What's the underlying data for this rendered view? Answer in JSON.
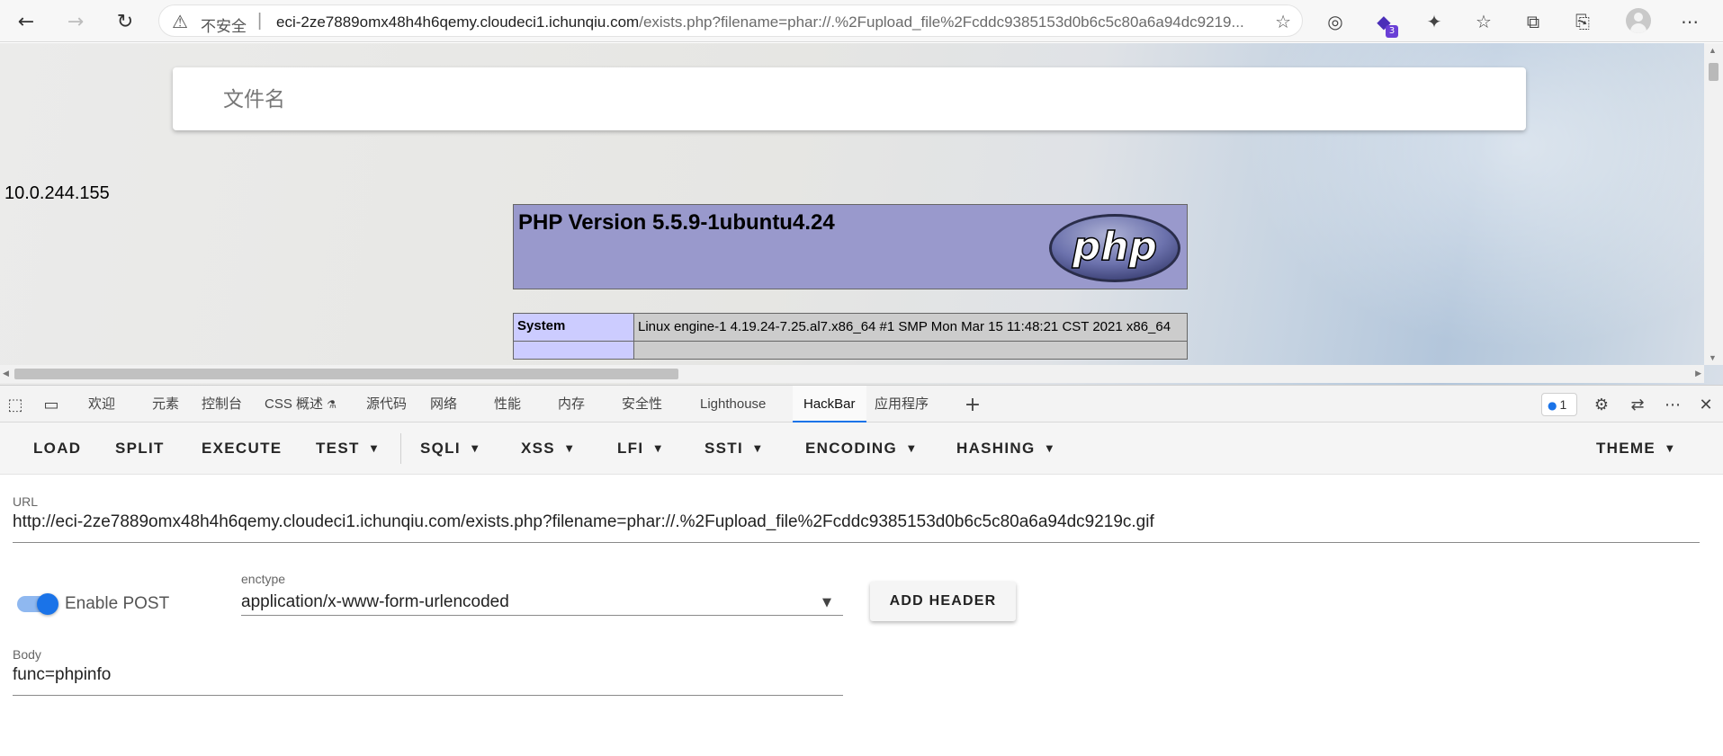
{
  "browser": {
    "nav": {
      "back_icon": "back-arrow-icon",
      "forward_icon": "forward-arrow-icon",
      "refresh_icon": "refresh-icon"
    },
    "address": {
      "security_label": "不安全",
      "host": "eci-2ze7889omx48h4h6qemy.cloudeci1.ichunqiu.com",
      "path": "/exists.php?filename=phar://.%2Fupload_file%2Fcddc9385153d0b6c5c80a6a94dc9219..."
    },
    "extensions": {
      "badge_count": "3"
    }
  },
  "page": {
    "search_placeholder": "文件名",
    "ip_address": "10.0.244.155",
    "php_version": "PHP Version 5.5.9-1ubuntu4.24",
    "php_logo_text": "php",
    "info_rows": [
      {
        "key": "System",
        "value": "Linux engine-1 4.19.24-7.25.al7.x86_64 #1 SMP Mon Mar 15 11:48:21 CST 2021 x86_64"
      }
    ]
  },
  "devtools": {
    "tabs": [
      "欢迎",
      "元素",
      "控制台",
      "CSS 概述",
      "源代码",
      "网络",
      "性能",
      "内存",
      "安全性",
      "Lighthouse",
      "HackBar",
      "应用程序"
    ],
    "active_tab": "HackBar",
    "css_overview_flask": "⚗",
    "issues_count": "1"
  },
  "hackbar": {
    "menu": [
      "LOAD",
      "SPLIT",
      "EXECUTE",
      "TEST",
      "SQLI",
      "XSS",
      "LFI",
      "SSTI",
      "ENCODING",
      "HASHING",
      "THEME"
    ],
    "url_label": "URL",
    "url_value": "http://eci-2ze7889omx48h4h6qemy.cloudeci1.ichunqiu.com/exists.php?filename=phar://.%2Fupload_file%2Fcddc9385153d0b6c5c80a6a94dc9219c.gif",
    "enable_post_label": "Enable POST",
    "enable_post": true,
    "enctype_label": "enctype",
    "enctype_value": "application/x-www-form-urlencoded",
    "add_header_label": "ADD HEADER",
    "body_label": "Body",
    "body_value": "func=phpinfo"
  },
  "colors": {
    "accent": "#1a73e8",
    "php_header": "#9999cc",
    "php_key_cell": "#ccccff",
    "php_value_cell": "#cccccc"
  }
}
